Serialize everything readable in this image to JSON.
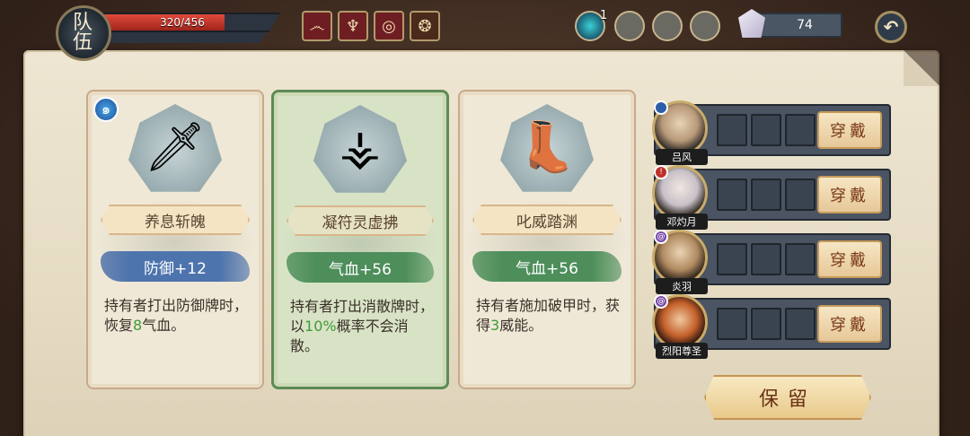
{
  "header": {
    "team_label_1": "队",
    "team_label_2": "伍",
    "hp_text": "320/456",
    "hp_fraction": 0.7018,
    "relics": [
      {
        "icon": "swirl-relic-icon",
        "color": "#6e1e22"
      },
      {
        "icon": "dragon-relic-icon",
        "color": "#6e1e22"
      },
      {
        "icon": "spiral-relic-icon",
        "color": "#6e1e22"
      },
      {
        "icon": "gourd-relic-icon",
        "color": "#4a2a1a"
      }
    ],
    "gem_count": "1",
    "crystal_count": "74"
  },
  "cards": [
    {
      "name": "养息斩魄",
      "stat": "防御+12",
      "stat_color": "blue",
      "desc_parts": [
        "持有者打出防御牌时，恢复",
        "8",
        "气血。"
      ],
      "icon": "sword-icon",
      "has_emblem": true
    },
    {
      "name": "凝符灵虚拂",
      "stat": "气血+56",
      "stat_color": "green",
      "desc_parts": [
        "持有者打出消散牌时，以",
        "10%",
        "概率不会消散。"
      ],
      "icon": "whisk-icon",
      "selected": true
    },
    {
      "name": "叱威踏渊",
      "stat": "气血+56",
      "stat_color": "green",
      "desc_parts": [
        "持有者施加破甲时，获得",
        "3",
        "威能。"
      ],
      "icon": "boots-icon"
    }
  ],
  "characters": [
    {
      "name": "吕风",
      "element_color": "#2b5da8",
      "button": "穿戴"
    },
    {
      "name": "邓灼月",
      "element_color": "#c0302a",
      "button": "穿戴"
    },
    {
      "name": "炎羽",
      "element_color": "#7a4aa8",
      "button": "穿戴"
    },
    {
      "name": "烈阳尊圣",
      "element_color": "#7a4aa8",
      "button": "穿戴"
    }
  ],
  "keep_button": "保留"
}
